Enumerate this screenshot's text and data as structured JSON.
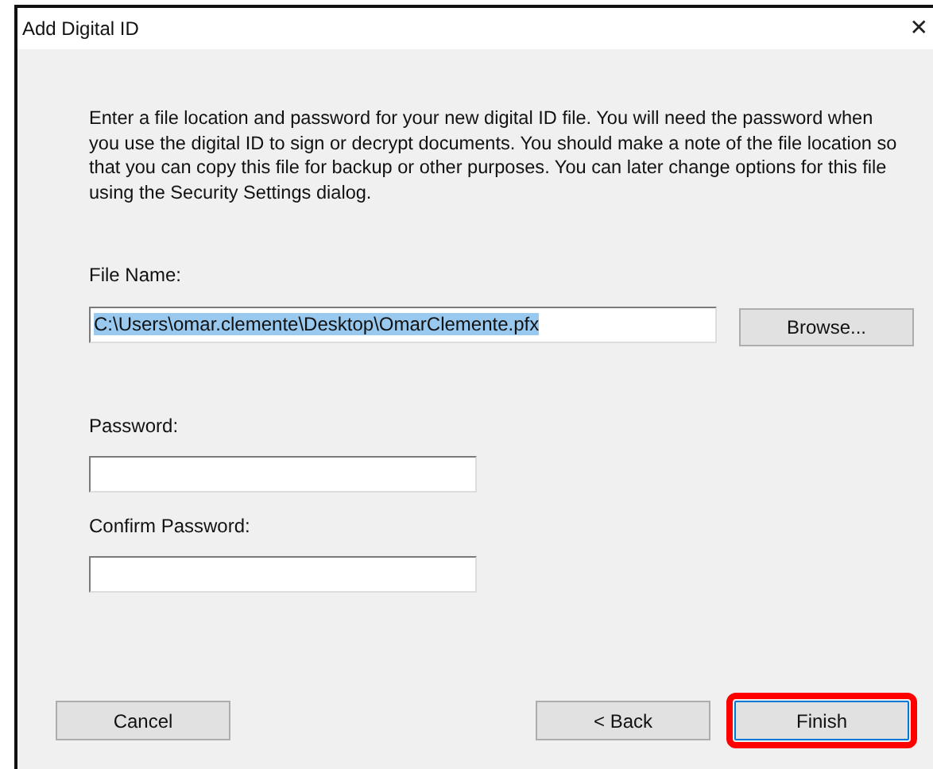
{
  "window": {
    "title": "Add Digital ID",
    "close": "✕"
  },
  "intro": "Enter a file location and password for your new digital ID file. You will need the password when you use the digital ID to sign or decrypt documents. You should make a note of the file location so that you can copy this file for backup or other purposes. You can later change options for this file using the Security Settings dialog.",
  "file_name": {
    "label": "File Name:",
    "value": "C:\\Users\\omar.clemente\\Desktop\\OmarClemente.pfx",
    "text_selected": true,
    "browse": "Browse..."
  },
  "password": {
    "label": "Password:"
  },
  "confirm_password": {
    "label": "Confirm Password:"
  },
  "buttons": [
    {
      "label": "Cancel",
      "highlighted": false
    },
    {
      "label": "< Back",
      "highlighted": false
    },
    {
      "label": "Finish",
      "highlighted": true
    }
  ]
}
